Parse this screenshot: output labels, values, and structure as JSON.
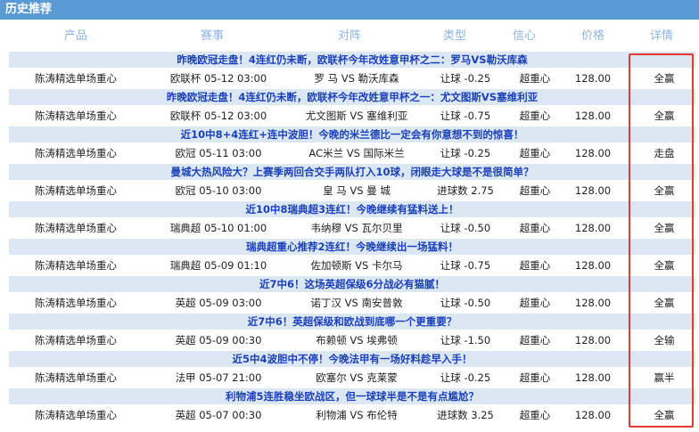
{
  "section": {
    "title": "历史推荐"
  },
  "columns": [
    "产品",
    "赛事",
    "对阵",
    "类型",
    "信心",
    "价格",
    "详情"
  ],
  "records": [
    {
      "headline": "昨晚欧冠走盘！4连红仍未断，欧联杯今年改姓意甲杯之二：罗马VS勒沃库森",
      "product": "陈涛精选单场重心",
      "event": "欧联杯 05-12 03:00",
      "match": "罗 马 VS 勒沃库森",
      "type": "让球 -0.25",
      "confidence": "超重心",
      "price": "128.00",
      "detail": "全赢"
    },
    {
      "headline": "昨晚欧冠走盘！4连红仍未断，欧联杯今年改姓意甲杯之一：尤文图斯VS塞维利亚",
      "product": "陈涛精选单场重心",
      "event": "欧联杯 05-12 03:00",
      "match": "尤文图斯 VS 塞维利亚",
      "type": "让球 -0.75",
      "confidence": "超重心",
      "price": "128.00",
      "detail": "全赢"
    },
    {
      "headline": "近10中8+4连红+连中波胆！今晚的米兰德比一定会有你意想不到的惊喜！",
      "product": "陈涛精选单场重心",
      "event": "欧冠 05-11 03:00",
      "match": "AC米兰 VS 国际米兰",
      "type": "让球 -0.25",
      "confidence": "超重心",
      "price": "128.00",
      "detail": "走盘"
    },
    {
      "headline": "曼城大热风险大？上赛季两回合交手两队打入10球，闭眼走大球是不是很简单？",
      "product": "陈涛精选单场重心",
      "event": "欧冠 05-10 03:00",
      "match": "皇 马 VS 曼 城",
      "type": "进球数 2.75",
      "confidence": "超重心",
      "price": "128.00",
      "detail": "全赢"
    },
    {
      "headline": "近10中8瑞典超3连红！今晚继续有猛料送上！",
      "product": "陈涛精选单场重心",
      "event": "瑞典超 05-10 01:00",
      "match": "韦纳穆 VS 瓦尔贝里",
      "type": "让球 -0.50",
      "confidence": "超重心",
      "price": "128.00",
      "detail": "全赢"
    },
    {
      "headline": "瑞典超重心推荐2连红！今晚继续出一场猛料！",
      "product": "陈涛精选单场重心",
      "event": "瑞典超 05-09 01:10",
      "match": "佐加顿斯 VS 卡尔马",
      "type": "让球 -0.75",
      "confidence": "超重心",
      "price": "128.00",
      "detail": "全赢"
    },
    {
      "headline": "近7中6！这场英超保级6分战必有猫腻！",
      "product": "陈涛精选单场重心",
      "event": "英超 05-09 03:00",
      "match": "诺丁汉 VS 南安普敦",
      "type": "让球 -0.50",
      "confidence": "超重心",
      "price": "128.00",
      "detail": "全赢"
    },
    {
      "headline": "近7中6！英超保级和欧战到底哪一个更重要？",
      "product": "陈涛精选单场重心",
      "event": "英超 05-09 00:30",
      "match": "布赖顿 VS 埃弗顿",
      "type": "让球 -1.50",
      "confidence": "超重心",
      "price": "128.00",
      "detail": "全输"
    },
    {
      "headline": "近5中4波胆中不停！今晚法甲有一场好料趁早入手！",
      "product": "陈涛精选单场重心",
      "event": "法甲 05-07 21:00",
      "match": "欧塞尔 VS 克莱蒙",
      "type": "让球 -0.25",
      "confidence": "超重心",
      "price": "128.00",
      "detail": "赢半"
    },
    {
      "headline": "利物浦5连胜稳坐欧战区，但一球球半是不是有点尴尬？",
      "product": "陈涛精选单场重心",
      "event": "英超 05-07 00:30",
      "match": "利物浦 VS 布伦特",
      "type": "进球数 3.25",
      "confidence": "超重心",
      "price": "128.00",
      "detail": "全赢"
    }
  ],
  "colors": {
    "header_bg": "#5b9bd5",
    "column_header_text": "#8db3e2",
    "headline_bg": "#dbe8f4",
    "headline_text": "#1b3fb8",
    "highlight_border": "#e53935"
  }
}
